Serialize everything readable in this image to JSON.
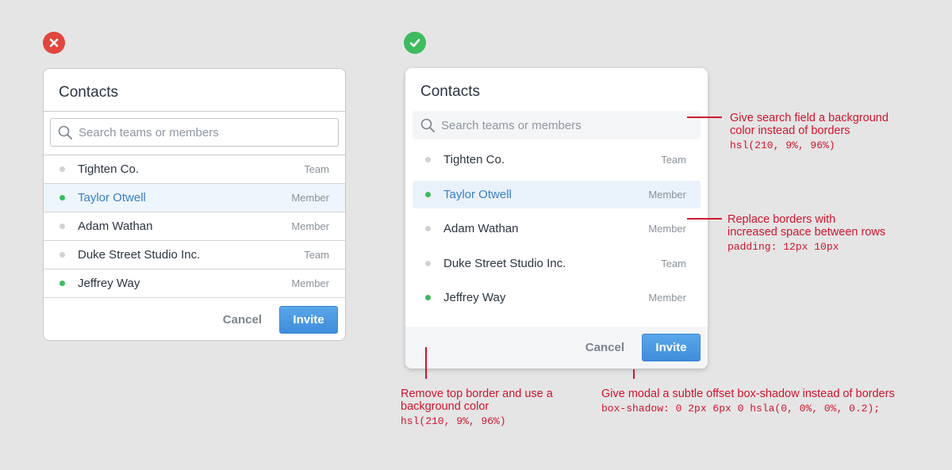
{
  "badges": {
    "bad": "x-icon",
    "good": "check-icon"
  },
  "colors": {
    "red_badge": "#e0463f",
    "green_badge": "#3dbb5e",
    "annotation": "#d0142c",
    "accent_blue": "#3a7fc4"
  },
  "modal_title": "Contacts",
  "search_placeholder": "Search teams or members",
  "contacts": [
    {
      "name": "Tighten Co.",
      "type": "Team",
      "status": "gray",
      "selected": false
    },
    {
      "name": "Taylor Otwell",
      "type": "Member",
      "status": "green",
      "selected": true
    },
    {
      "name": "Adam Wathan",
      "type": "Member",
      "status": "gray",
      "selected": false
    },
    {
      "name": "Duke Street Studio Inc.",
      "type": "Team",
      "status": "gray",
      "selected": false
    },
    {
      "name": "Jeffrey Way",
      "type": "Member",
      "status": "green",
      "selected": false
    }
  ],
  "buttons": {
    "cancel": "Cancel",
    "invite": "Invite"
  },
  "annotations": {
    "search": {
      "line1": "Give search field a background",
      "line2": "color instead of borders",
      "code": "hsl(210, 9%, 96%)"
    },
    "rows": {
      "line1": "Replace borders with",
      "line2": "increased space between rows",
      "code": "padding: 12px 10px"
    },
    "footer": {
      "line1": "Remove top border and use a",
      "line2": "background color",
      "code": "hsl(210, 9%, 96%)"
    },
    "shadow": {
      "line1": "Give modal a subtle offset box-shadow instead of borders",
      "code": "box-shadow: 0 2px 6px 0 hsla(0, 0%, 0%, 0.2);"
    }
  }
}
